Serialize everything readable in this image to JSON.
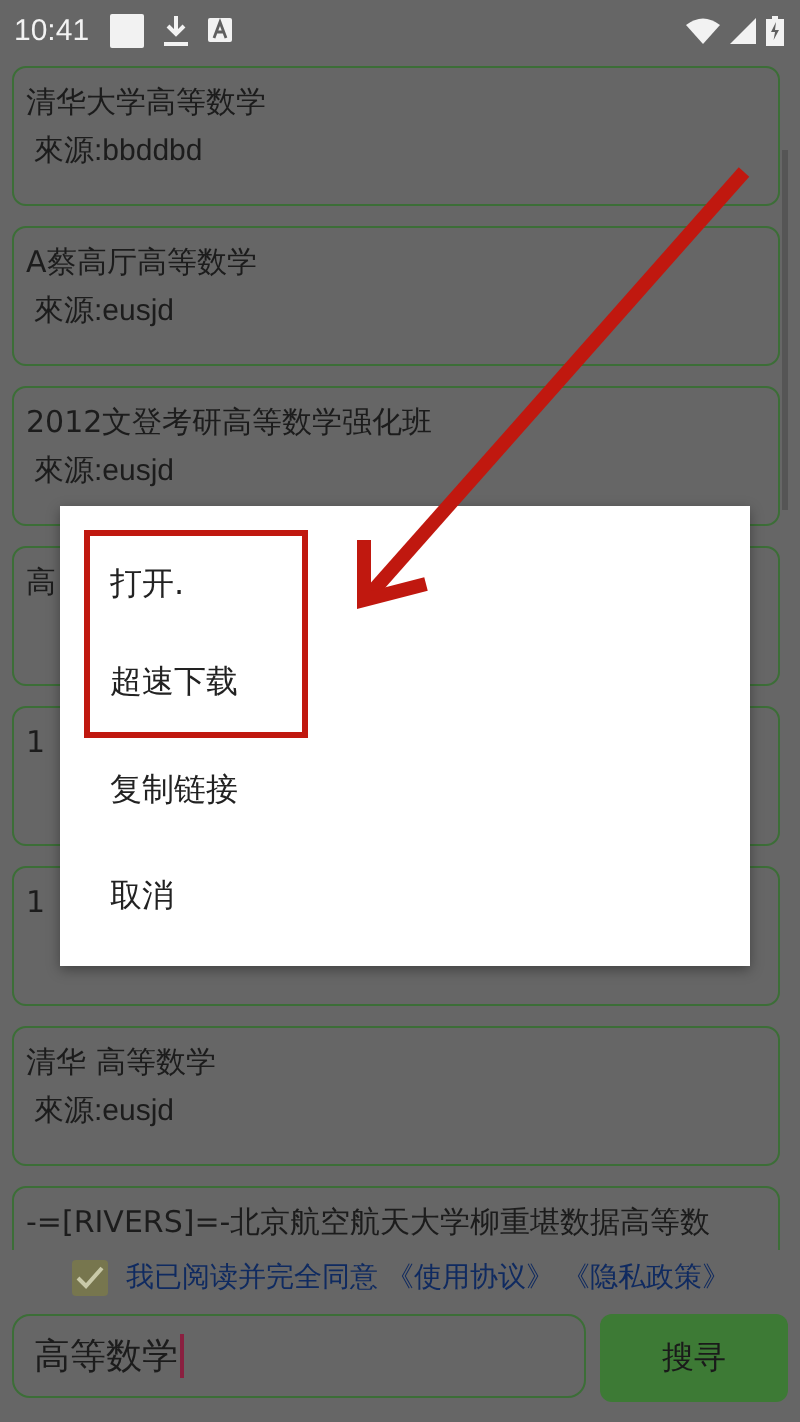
{
  "status_bar": {
    "time": "10:41"
  },
  "results": [
    {
      "title": "清华大学高等数学",
      "source": "來源:bbddbd"
    },
    {
      "title": "A蔡高厅高等数学",
      "source": "來源:eusjd"
    },
    {
      "title": "2012文登考研高等数学强化班",
      "source": "來源:eusjd"
    },
    {
      "title": "高"
    },
    {
      "title": "1"
    },
    {
      "title": "1"
    },
    {
      "title": "清华 高等数学",
      "source": "來源:eusjd"
    },
    {
      "title": "-=[RIVERS]=-北京航空航天大学柳重堪数据高等数"
    }
  ],
  "dialog": {
    "items": [
      {
        "label": "打开.",
        "highlighted": true
      },
      {
        "label": "超速下载",
        "highlighted": true
      },
      {
        "label": "复制链接",
        "highlighted": false
      },
      {
        "label": "取消",
        "highlighted": false
      }
    ]
  },
  "agreement": {
    "checked": true,
    "text": "我已阅读并完全同意",
    "links": [
      "《使用协议》",
      "《隐私政策》"
    ]
  },
  "search": {
    "value": "高等数学",
    "button": "搜寻"
  }
}
